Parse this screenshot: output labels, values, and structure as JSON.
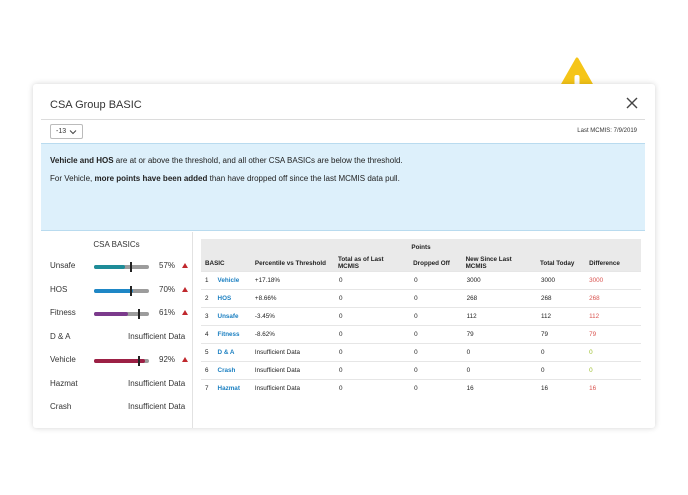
{
  "dialog": {
    "title": "CSA Group BASIC",
    "period_select": "-13",
    "last_mcmis": "Last MCMIS: 7/9/2019"
  },
  "banner": {
    "line1_bold": "Vehicle and HOS",
    "line1_rest": " are at or above the threshold, and all other CSA BASICs are below the threshold.",
    "line2_pre": "For Vehicle, ",
    "line2_bold": "more points have been added",
    "line2_rest": " than have dropped off since the last MCMIS data pull."
  },
  "basics": {
    "heading": "CSA BASICs",
    "items": [
      {
        "name": "Unsafe",
        "value": "57%",
        "fill_pct": 57,
        "color": "#1e8c98",
        "threshold_pct": 65,
        "arrow": true
      },
      {
        "name": "HOS",
        "value": "70%",
        "fill_pct": 70,
        "color": "#1e87c6",
        "threshold_pct": 65,
        "arrow": true
      },
      {
        "name": "Fitness",
        "value": "61%",
        "fill_pct": 61,
        "color": "#7b3a8c",
        "threshold_pct": 80,
        "arrow": true
      },
      {
        "name": "D & A",
        "value": "Insufficient Data"
      },
      {
        "name": "Vehicle",
        "value": "92%",
        "fill_pct": 92,
        "color": "#9c2045",
        "threshold_pct": 80,
        "arrow": true
      },
      {
        "name": "Hazmat",
        "value": "Insufficient Data"
      },
      {
        "name": "Crash",
        "value": "Insufficient Data"
      }
    ]
  },
  "table": {
    "group_header": "Points",
    "headers": [
      "BASIC",
      "Percentile vs Threshold",
      "Total as of Last MCMIS",
      "Dropped Off",
      "New Since Last MCMIS",
      "Total Today",
      "Difference"
    ],
    "rows": [
      {
        "n": "1",
        "basic": "Vehicle",
        "pct": "+17.18%",
        "total_last": "0",
        "dropped": "0",
        "new": "3000",
        "today": "3000",
        "diff": "3000",
        "diff_color": "red"
      },
      {
        "n": "2",
        "basic": "HOS",
        "pct": "+8.66%",
        "total_last": "0",
        "dropped": "0",
        "new": "268",
        "today": "268",
        "diff": "268",
        "diff_color": "red"
      },
      {
        "n": "3",
        "basic": "Unsafe",
        "pct": "-3.45%",
        "total_last": "0",
        "dropped": "0",
        "new": "112",
        "today": "112",
        "diff": "112",
        "diff_color": "red"
      },
      {
        "n": "4",
        "basic": "Fitness",
        "pct": "-8.62%",
        "total_last": "0",
        "dropped": "0",
        "new": "79",
        "today": "79",
        "diff": "79",
        "diff_color": "red"
      },
      {
        "n": "5",
        "basic": "D & A",
        "pct": "Insufficient Data",
        "total_last": "0",
        "dropped": "0",
        "new": "0",
        "today": "0",
        "diff": "0",
        "diff_color": "green"
      },
      {
        "n": "6",
        "basic": "Crash",
        "pct": "Insufficient Data",
        "total_last": "0",
        "dropped": "0",
        "new": "0",
        "today": "0",
        "diff": "0",
        "diff_color": "green"
      },
      {
        "n": "7",
        "basic": "Hazmat",
        "pct": "Insufficient Data",
        "total_last": "0",
        "dropped": "0",
        "new": "16",
        "today": "16",
        "diff": "16",
        "diff_color": "red"
      }
    ]
  },
  "colors": {
    "warning": "#f5c518",
    "link": "#1a7fc1",
    "banner_bg": "#ddf0fb",
    "up_arrow": "#c0282d"
  }
}
